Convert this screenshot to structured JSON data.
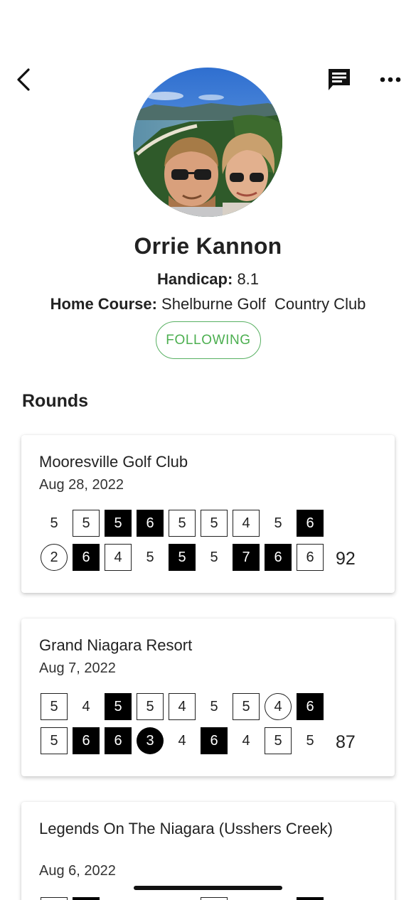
{
  "header": {
    "back_icon": "chevron-left-icon",
    "message_icon": "chat-bubble-icon",
    "more_icon": "ellipsis-icon"
  },
  "profile": {
    "name": "Orrie Kannon",
    "handicap_label": "Handicap:",
    "handicap_value": "8.1",
    "home_course_label": "Home Course:",
    "home_course_value": "Shelburne Golf  Country Club",
    "follow_label": "FOLLOWING",
    "follow_color": "#4caf50"
  },
  "rounds": {
    "title": "Rounds",
    "items": [
      {
        "course": "Mooresville Golf Club",
        "date": "Aug 28, 2022",
        "total": "92",
        "row1": [
          {
            "v": "5",
            "s": "plain"
          },
          {
            "v": "5",
            "s": "box"
          },
          {
            "v": "5",
            "s": "filled"
          },
          {
            "v": "6",
            "s": "filled"
          },
          {
            "v": "5",
            "s": "box"
          },
          {
            "v": "5",
            "s": "box"
          },
          {
            "v": "4",
            "s": "box"
          },
          {
            "v": "5",
            "s": "plain"
          },
          {
            "v": "6",
            "s": "filled"
          }
        ],
        "row2": [
          {
            "v": "2",
            "s": "circle"
          },
          {
            "v": "6",
            "s": "filled"
          },
          {
            "v": "4",
            "s": "box"
          },
          {
            "v": "5",
            "s": "plain"
          },
          {
            "v": "5",
            "s": "filled"
          },
          {
            "v": "5",
            "s": "plain"
          },
          {
            "v": "7",
            "s": "filled"
          },
          {
            "v": "6",
            "s": "filled"
          },
          {
            "v": "6",
            "s": "box"
          }
        ]
      },
      {
        "course": "Grand Niagara Resort",
        "date": "Aug 7, 2022",
        "total": "87",
        "row1": [
          {
            "v": "5",
            "s": "box"
          },
          {
            "v": "4",
            "s": "plain"
          },
          {
            "v": "5",
            "s": "filled"
          },
          {
            "v": "5",
            "s": "box"
          },
          {
            "v": "4",
            "s": "box"
          },
          {
            "v": "5",
            "s": "plain"
          },
          {
            "v": "5",
            "s": "box"
          },
          {
            "v": "4",
            "s": "circle"
          },
          {
            "v": "6",
            "s": "filled"
          }
        ],
        "row2": [
          {
            "v": "5",
            "s": "box"
          },
          {
            "v": "6",
            "s": "filled"
          },
          {
            "v": "6",
            "s": "filled"
          },
          {
            "v": "3",
            "s": "circle-filled"
          },
          {
            "v": "4",
            "s": "plain"
          },
          {
            "v": "6",
            "s": "filled"
          },
          {
            "v": "4",
            "s": "plain"
          },
          {
            "v": "5",
            "s": "box"
          },
          {
            "v": "5",
            "s": "plain"
          }
        ]
      },
      {
        "course": "Legends On The Niagara (Usshers Creek)",
        "date": "Aug 6, 2022"
      }
    ]
  }
}
